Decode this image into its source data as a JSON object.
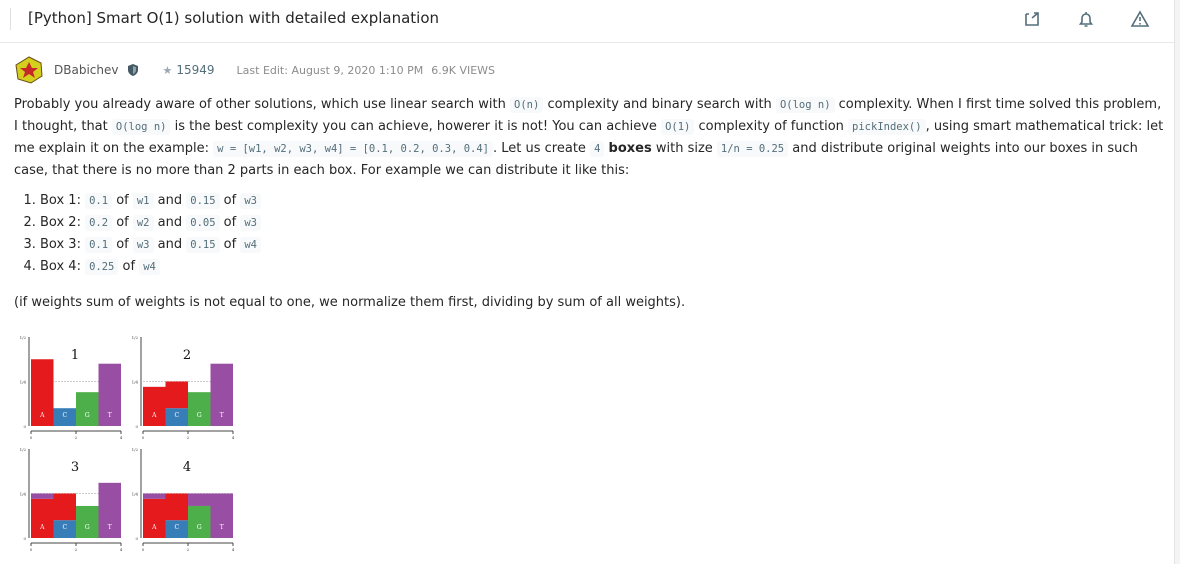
{
  "header": {
    "title": "[Python] Smart O(1) solution with detailed explanation",
    "icons": [
      "share-icon",
      "bell-icon",
      "warning-icon"
    ]
  },
  "meta": {
    "username": "DBabichev",
    "reputation": "15949",
    "last_edit": "Last Edit: August 9, 2020 1:10 PM",
    "views": "6.9K VIEWS"
  },
  "paragraph": [
    {
      "t": "text",
      "v": "Probably you already aware of other solutions, which use linear search with "
    },
    {
      "t": "code",
      "v": "O(n)"
    },
    {
      "t": "text",
      "v": " complexity and binary search with "
    },
    {
      "t": "code",
      "v": "O(log n)"
    },
    {
      "t": "text",
      "v": " complexity. When I first time solved this problem, I thought, that "
    },
    {
      "t": "code",
      "v": "O(log n)"
    },
    {
      "t": "text",
      "v": " is the best complexity you can achieve, howerer it is not! You can achieve "
    },
    {
      "t": "code",
      "v": "O(1)"
    },
    {
      "t": "text",
      "v": " complexity of function "
    },
    {
      "t": "code",
      "v": "pickIndex()"
    },
    {
      "t": "text",
      "v": ", using smart mathematical trick: let me explain it on the example: "
    },
    {
      "t": "code",
      "v": "w = [w1, w2, w3, w4] = [0.1, 0.2, 0.3, 0.4]"
    },
    {
      "t": "text",
      "v": ". Let us create "
    },
    {
      "t": "code",
      "v": "4"
    },
    {
      "t": "text",
      "v": " "
    },
    {
      "t": "bold",
      "v": "boxes"
    },
    {
      "t": "text",
      "v": " with size "
    },
    {
      "t": "code",
      "v": "1/n = 0.25"
    },
    {
      "t": "text",
      "v": " and distribute original weights into our boxes in such case, that there is no more than 2 parts in each box. For example we can distribute it like this:"
    }
  ],
  "list": [
    [
      {
        "t": "text",
        "v": "Box 1: "
      },
      {
        "t": "code",
        "v": "0.1"
      },
      {
        "t": "text",
        "v": " of "
      },
      {
        "t": "code",
        "v": "w1"
      },
      {
        "t": "text",
        "v": " and "
      },
      {
        "t": "code",
        "v": "0.15"
      },
      {
        "t": "text",
        "v": " of "
      },
      {
        "t": "code",
        "v": "w3"
      }
    ],
    [
      {
        "t": "text",
        "v": "Box 2: "
      },
      {
        "t": "code",
        "v": "0.2"
      },
      {
        "t": "text",
        "v": " of "
      },
      {
        "t": "code",
        "v": "w2"
      },
      {
        "t": "text",
        "v": " and "
      },
      {
        "t": "code",
        "v": "0.05"
      },
      {
        "t": "text",
        "v": " of "
      },
      {
        "t": "code",
        "v": "w3"
      }
    ],
    [
      {
        "t": "text",
        "v": "Box 3: "
      },
      {
        "t": "code",
        "v": "0.1"
      },
      {
        "t": "text",
        "v": " of "
      },
      {
        "t": "code",
        "v": "w3"
      },
      {
        "t": "text",
        "v": " and "
      },
      {
        "t": "code",
        "v": "0.15"
      },
      {
        "t": "text",
        "v": " of "
      },
      {
        "t": "code",
        "v": "w4"
      }
    ],
    [
      {
        "t": "text",
        "v": "Box 4: "
      },
      {
        "t": "code",
        "v": "0.25"
      },
      {
        "t": "text",
        "v": " of "
      },
      {
        "t": "code",
        "v": "w4"
      }
    ]
  ],
  "after": "(if weights sum of weights is not equal to one, we normalize them first, dividing by sum of all weights).",
  "figure": {
    "y_ticks": [
      "0",
      "1/4",
      "1/2"
    ],
    "x_ticks": [
      "0",
      "2",
      "4"
    ],
    "bar_labels": [
      "A",
      "C",
      "G",
      "T"
    ],
    "colors": {
      "red": "#e41a1c",
      "blue": "#377eb8",
      "green": "#4daf4a",
      "purple": "#984ea3"
    },
    "panels": [
      {
        "label": "1",
        "bars": [
          [
            [
              "red",
              0,
              0.375
            ]
          ],
          [
            [
              "blue",
              0,
              0.1
            ]
          ],
          [
            [
              "green",
              0,
              0.19
            ]
          ],
          [
            [
              "purple",
              0,
              0.35
            ]
          ]
        ]
      },
      {
        "label": "2",
        "bars": [
          [
            [
              "red",
              0,
              0.22
            ]
          ],
          [
            [
              "blue",
              0,
              0.1
            ],
            [
              "red",
              0.1,
              0.25
            ]
          ],
          [
            [
              "green",
              0,
              0.19
            ]
          ],
          [
            [
              "purple",
              0,
              0.35
            ]
          ]
        ]
      },
      {
        "label": "3",
        "bars": [
          [
            [
              "red",
              0,
              0.22
            ],
            [
              "purple",
              0.22,
              0.25
            ]
          ],
          [
            [
              "blue",
              0,
              0.1
            ],
            [
              "red",
              0.1,
              0.25
            ]
          ],
          [
            [
              "green",
              0,
              0.18
            ]
          ],
          [
            [
              "purple",
              0,
              0.31
            ]
          ]
        ]
      },
      {
        "label": "4",
        "bars": [
          [
            [
              "red",
              0,
              0.22
            ],
            [
              "purple",
              0.22,
              0.25
            ]
          ],
          [
            [
              "blue",
              0,
              0.1
            ],
            [
              "red",
              0.1,
              0.25
            ]
          ],
          [
            [
              "green",
              0,
              0.18
            ],
            [
              "purple",
              0.18,
              0.25
            ]
          ],
          [
            [
              "purple",
              0,
              0.25
            ]
          ]
        ]
      }
    ]
  }
}
